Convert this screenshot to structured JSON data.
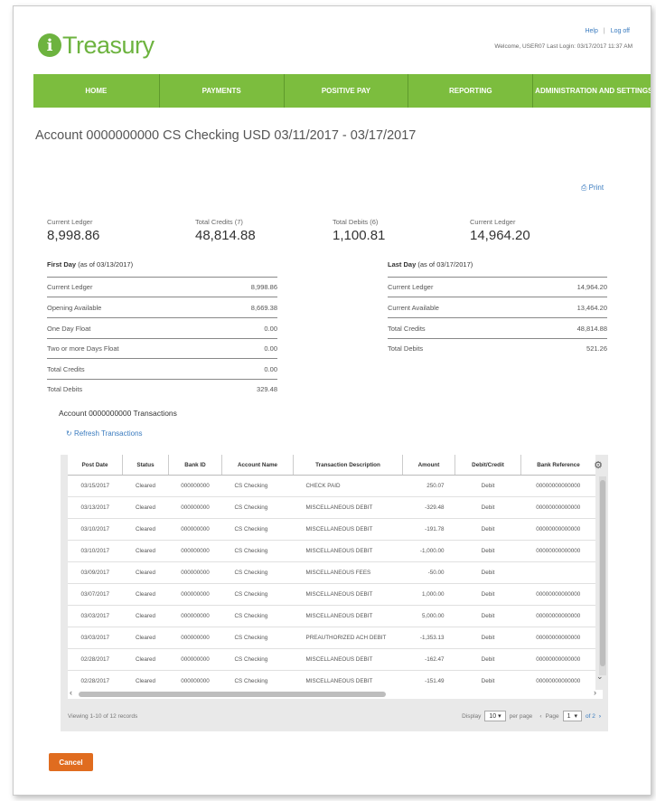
{
  "brand": {
    "logo_letter": "i",
    "logo_text": "Treasury",
    "color": "#6db33f"
  },
  "top_links": {
    "help": "Help",
    "separator": "|",
    "logoff": "Log off"
  },
  "welcome": "Welcome, USER07 Last Login: 03/17/2017 11:37 AM",
  "nav": [
    {
      "label": "HOME"
    },
    {
      "label": "PAYMENTS"
    },
    {
      "label": "POSITIVE PAY"
    },
    {
      "label": "REPORTING"
    },
    {
      "label": "ADMINISTRATION AND SETTINGS"
    }
  ],
  "account_title": "Account 0000000000   CS Checking USD   03/11/2017 - 03/17/2017",
  "print_label": "Print",
  "stats": [
    {
      "label": "Current Ledger",
      "value": "8,998.86"
    },
    {
      "label": "Total Credits (7)",
      "value": "48,814.88"
    },
    {
      "label": "Total Debits (6)",
      "value": "1,100.81"
    },
    {
      "label": "Current Ledger",
      "value": "14,964.20"
    }
  ],
  "first_day": {
    "title": "First Day",
    "as_of": "(as of 03/13/2017)",
    "rows": [
      {
        "label": "Current Ledger",
        "value": "8,998.86"
      },
      {
        "label": "Opening Available",
        "value": "8,669.38"
      },
      {
        "label": "One Day Float",
        "value": "0.00"
      },
      {
        "label": "Two or more Days Float",
        "value": "0.00"
      },
      {
        "label": "Total Credits",
        "value": "0.00"
      },
      {
        "label": "Total Debits",
        "value": "329.48"
      }
    ]
  },
  "last_day": {
    "title": "Last Day",
    "as_of": "(as of 03/17/2017)",
    "rows": [
      {
        "label": "Current Ledger",
        "value": "14,964.20"
      },
      {
        "label": "Current Available",
        "value": "13,464.20"
      },
      {
        "label": "Total Credits",
        "value": "48,814.88"
      },
      {
        "label": "Total Debits",
        "value": "521.26"
      }
    ]
  },
  "transactions_title": "Account 0000000000 Transactions",
  "refresh_label": "Refresh Transactions",
  "table": {
    "columns": [
      "Post Date",
      "Status",
      "Bank ID",
      "Account Name",
      "Transaction Description",
      "Amount",
      "Debit/Credit",
      "Bank Reference"
    ],
    "rows": [
      [
        "03/15/2017",
        "Cleared",
        "000000000",
        "CS Checking",
        "CHECK PAID",
        "250.07",
        "Debit",
        "00000000000000"
      ],
      [
        "03/13/2017",
        "Cleared",
        "000000000",
        "CS Checking",
        "MISCELLANEOUS DEBIT",
        "-329.48",
        "Debit",
        "00000000000000"
      ],
      [
        "03/10/2017",
        "Cleared",
        "000000000",
        "CS Checking",
        "MISCELLANEOUS DEBIT",
        "-191.78",
        "Debit",
        "00000000000000"
      ],
      [
        "03/10/2017",
        "Cleared",
        "000000000",
        "CS Checking",
        "MISCELLANEOUS DEBIT",
        "-1,000.00",
        "Debit",
        "00000000000000"
      ],
      [
        "03/09/2017",
        "Cleared",
        "000000000",
        "CS Checking",
        "MISCELLANEOUS FEES",
        "-50.00",
        "Debit",
        ""
      ],
      [
        "03/07/2017",
        "Cleared",
        "000000000",
        "CS Checking",
        "MISCELLANEOUS DEBIT",
        "1,000.00",
        "Debit",
        "00000000000000"
      ],
      [
        "03/03/2017",
        "Cleared",
        "000000000",
        "CS Checking",
        "MISCELLANEOUS DEBIT",
        "5,000.00",
        "Debit",
        "00000000000000"
      ],
      [
        "03/03/2017",
        "Cleared",
        "000000000",
        "CS Checking",
        "PREAUTHORIZED ACH DEBIT",
        "-1,353.13",
        "Debit",
        "00000000000000"
      ],
      [
        "02/28/2017",
        "Cleared",
        "000000000",
        "CS Checking",
        "MISCELLANEOUS DEBIT",
        "-162.47",
        "Debit",
        "00000000000000"
      ],
      [
        "02/28/2017",
        "Cleared",
        "000000000",
        "CS Checking",
        "MISCELLANEOUS DEBIT",
        "-151.49",
        "Debit",
        "00000000000000"
      ]
    ]
  },
  "footer": {
    "viewing": "Viewing 1-10 of 12 records",
    "display_label": "Display",
    "per_page_value": "10",
    "per_page_label": "per page",
    "page_label": "Page",
    "page_value": "1",
    "of_pages": "of 2"
  },
  "cancel_label": "Cancel"
}
